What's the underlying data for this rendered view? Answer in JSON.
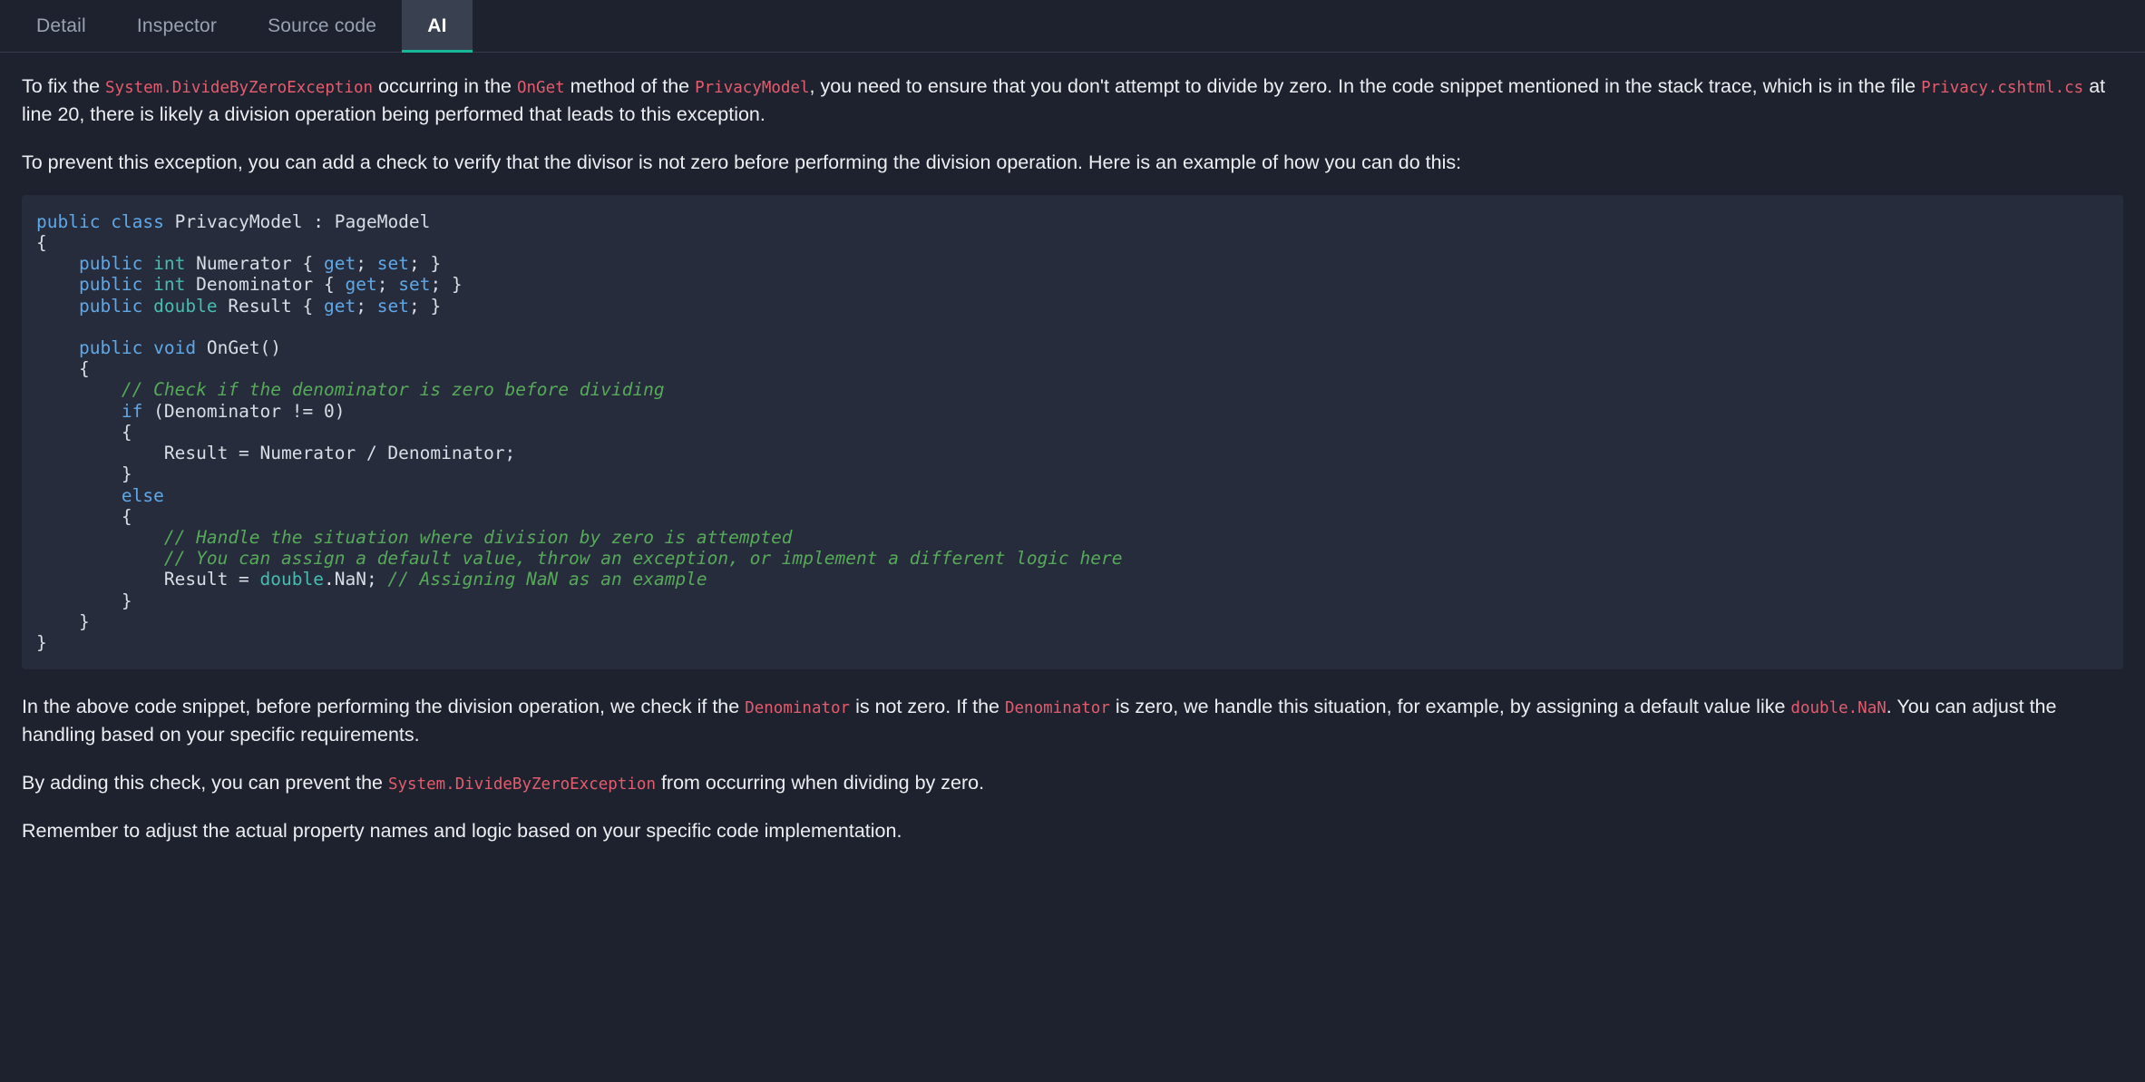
{
  "tabs": [
    {
      "label": "Detail",
      "active": false
    },
    {
      "label": "Inspector",
      "active": false
    },
    {
      "label": "Source code",
      "active": false
    },
    {
      "label": "AI",
      "active": true
    }
  ],
  "colors": {
    "page_bg": "#1d222e",
    "code_bg": "#262c3b",
    "active_tab_bg": "#39404f",
    "active_tab_underline": "#17b89a",
    "inline_code": "#e45c6d",
    "keyword": "#5fa8e8",
    "type": "#45bdb0",
    "comment": "#57a95a",
    "text": "#eceef1"
  },
  "paragraphs": {
    "p1": {
      "s1": "To fix the ",
      "c1": "System.DivideByZeroException",
      "s2": " occurring in the ",
      "c2": "OnGet",
      "s3": " method of the ",
      "c3": "PrivacyModel",
      "s4": ", you need to ensure that you don't attempt to divide by zero. In the code snippet mentioned in the stack trace, which is in the file ",
      "c4": "Privacy.cshtml.cs",
      "s5": " at line 20, there is likely a division operation being performed that leads to this exception."
    },
    "p2": "To prevent this exception, you can add a check to verify that the divisor is not zero before performing the division operation. Here is an example of how you can do this:",
    "p3": {
      "s1": "In the above code snippet, before performing the division operation, we check if the ",
      "c1": "Denominator",
      "s2": " is not zero. If the ",
      "c2": "Denominator",
      "s3": " is zero, we handle this situation, for example, by assigning a default value like ",
      "c3": "double.NaN",
      "s4": ". You can adjust the handling based on your specific requirements."
    },
    "p4": {
      "s1": "By adding this check, you can prevent the ",
      "c1": "System.DivideByZeroException",
      "s2": " from occurring when dividing by zero."
    },
    "p5": "Remember to adjust the actual property names and logic based on your specific code implementation."
  },
  "code_block": {
    "language": "csharp",
    "lines": [
      [
        {
          "t": "kw",
          "v": "public "
        },
        {
          "t": "kw",
          "v": "class "
        },
        {
          "t": "pln",
          "v": "PrivacyModel : PageModel"
        }
      ],
      [
        {
          "t": "pln",
          "v": "{"
        }
      ],
      [
        {
          "t": "pln",
          "v": "    "
        },
        {
          "t": "kw",
          "v": "public "
        },
        {
          "t": "typ",
          "v": "int "
        },
        {
          "t": "pln",
          "v": "Numerator { "
        },
        {
          "t": "kw",
          "v": "get"
        },
        {
          "t": "pln",
          "v": "; "
        },
        {
          "t": "kw",
          "v": "set"
        },
        {
          "t": "pln",
          "v": "; }"
        }
      ],
      [
        {
          "t": "pln",
          "v": "    "
        },
        {
          "t": "kw",
          "v": "public "
        },
        {
          "t": "typ",
          "v": "int "
        },
        {
          "t": "pln",
          "v": "Denominator { "
        },
        {
          "t": "kw",
          "v": "get"
        },
        {
          "t": "pln",
          "v": "; "
        },
        {
          "t": "kw",
          "v": "set"
        },
        {
          "t": "pln",
          "v": "; }"
        }
      ],
      [
        {
          "t": "pln",
          "v": "    "
        },
        {
          "t": "kw",
          "v": "public "
        },
        {
          "t": "typ",
          "v": "double "
        },
        {
          "t": "pln",
          "v": "Result { "
        },
        {
          "t": "kw",
          "v": "get"
        },
        {
          "t": "pln",
          "v": "; "
        },
        {
          "t": "kw",
          "v": "set"
        },
        {
          "t": "pln",
          "v": "; }"
        }
      ],
      [
        {
          "t": "pln",
          "v": ""
        }
      ],
      [
        {
          "t": "pln",
          "v": "    "
        },
        {
          "t": "kw",
          "v": "public "
        },
        {
          "t": "kw",
          "v": "void "
        },
        {
          "t": "pln",
          "v": "OnGet()"
        }
      ],
      [
        {
          "t": "pln",
          "v": "    {"
        }
      ],
      [
        {
          "t": "pln",
          "v": "        "
        },
        {
          "t": "cmt",
          "v": "// Check if the denominator is zero before dividing"
        }
      ],
      [
        {
          "t": "pln",
          "v": "        "
        },
        {
          "t": "kw",
          "v": "if "
        },
        {
          "t": "pln",
          "v": "(Denominator != 0)"
        }
      ],
      [
        {
          "t": "pln",
          "v": "        {"
        }
      ],
      [
        {
          "t": "pln",
          "v": "            Result = Numerator / Denominator;"
        }
      ],
      [
        {
          "t": "pln",
          "v": "        }"
        }
      ],
      [
        {
          "t": "pln",
          "v": "        "
        },
        {
          "t": "kw",
          "v": "else"
        }
      ],
      [
        {
          "t": "pln",
          "v": "        {"
        }
      ],
      [
        {
          "t": "pln",
          "v": "            "
        },
        {
          "t": "cmt",
          "v": "// Handle the situation where division by zero is attempted"
        }
      ],
      [
        {
          "t": "pln",
          "v": "            "
        },
        {
          "t": "cmt",
          "v": "// You can assign a default value, throw an exception, or implement a different logic here"
        }
      ],
      [
        {
          "t": "pln",
          "v": "            Result = "
        },
        {
          "t": "typ",
          "v": "double"
        },
        {
          "t": "pln",
          "v": ".NaN; "
        },
        {
          "t": "cmt",
          "v": "// Assigning NaN as an example"
        }
      ],
      [
        {
          "t": "pln",
          "v": "        }"
        }
      ],
      [
        {
          "t": "pln",
          "v": "    }"
        }
      ],
      [
        {
          "t": "pln",
          "v": "}"
        }
      ]
    ]
  }
}
